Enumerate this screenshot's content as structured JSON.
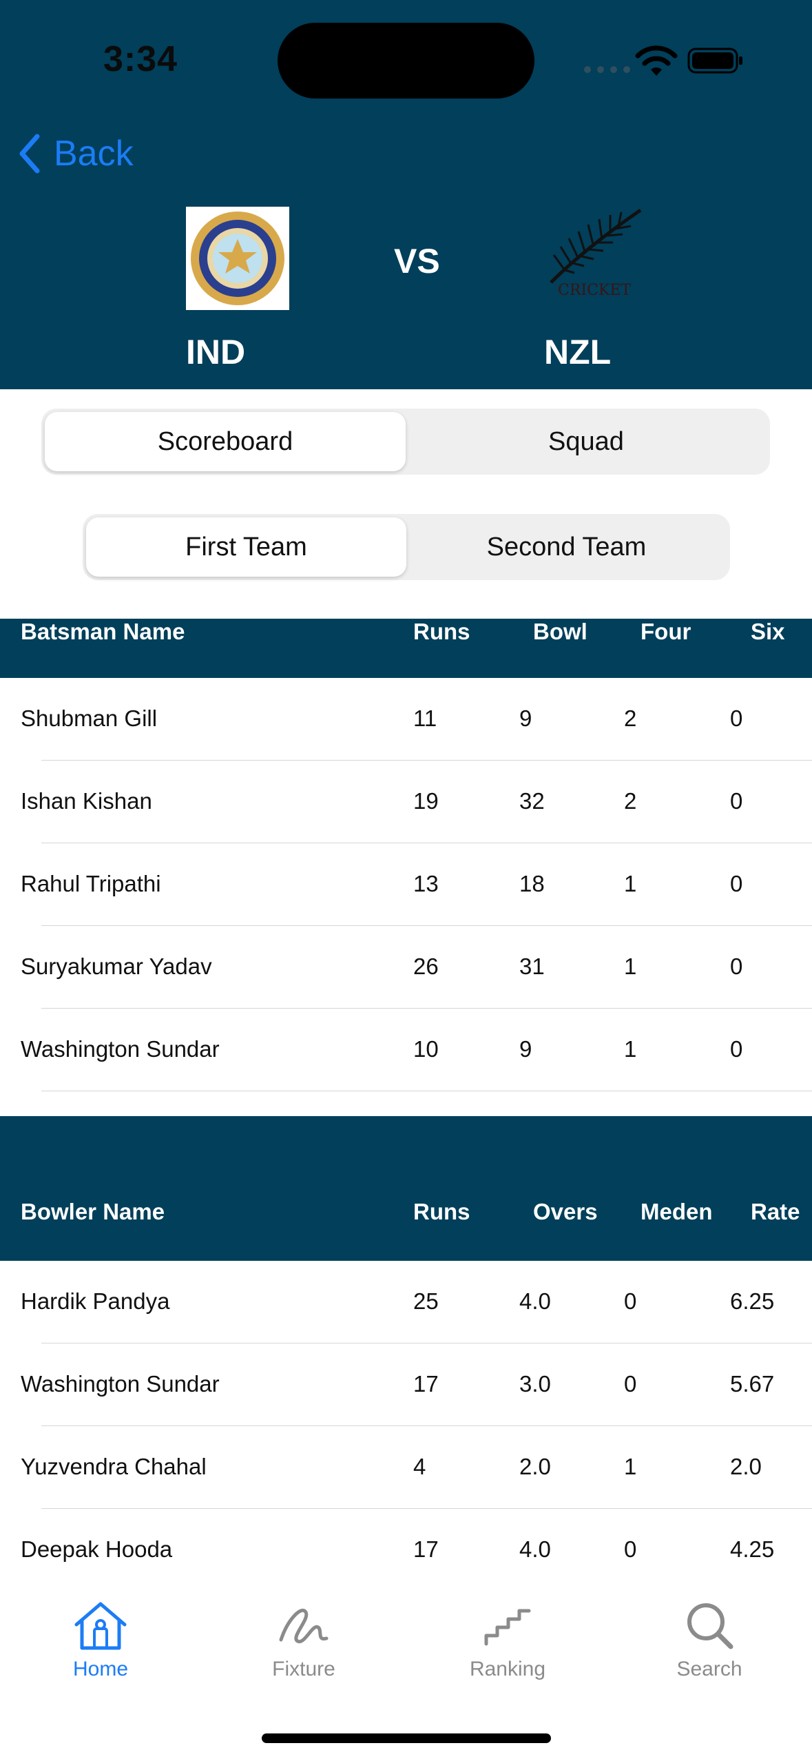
{
  "status_bar": {
    "time": "3:34"
  },
  "nav": {
    "back_label": "Back"
  },
  "match": {
    "vs_label": "VS",
    "team1": {
      "code": "IND"
    },
    "team2": {
      "code": "NZL"
    }
  },
  "segment_main": {
    "options": [
      "Scoreboard",
      "Squad"
    ],
    "selected": "Scoreboard"
  },
  "segment_team": {
    "options": [
      "First Team",
      "Second Team"
    ],
    "selected": "First Team"
  },
  "batting": {
    "headers": [
      "Batsman Name",
      "Runs",
      "Bowl",
      "Four",
      "Six"
    ],
    "rows": [
      [
        "Shubman Gill",
        "11",
        "9",
        "2",
        "0"
      ],
      [
        "Ishan Kishan",
        "19",
        "32",
        "2",
        "0"
      ],
      [
        "Rahul Tripathi",
        "13",
        "18",
        "1",
        "0"
      ],
      [
        "Suryakumar Yadav",
        "26",
        "31",
        "1",
        "0"
      ],
      [
        "Washington Sundar",
        "10",
        "9",
        "1",
        "0"
      ]
    ]
  },
  "bowling": {
    "headers": [
      "Bowler Name",
      "Runs",
      "Overs",
      "Meden",
      "Rate"
    ],
    "rows": [
      [
        "Hardik Pandya",
        "25",
        "4.0",
        "0",
        "6.25"
      ],
      [
        "Washington Sundar",
        "17",
        "3.0",
        "0",
        "5.67"
      ],
      [
        "Yuzvendra Chahal",
        "4",
        "2.0",
        "1",
        "2.0"
      ],
      [
        "Deepak Hooda",
        "17",
        "4.0",
        "0",
        "4.25"
      ]
    ]
  },
  "tab_bar": {
    "tabs": [
      {
        "label": "Home",
        "icon": "home-icon"
      },
      {
        "label": "Fixture",
        "icon": "scribble-icon"
      },
      {
        "label": "Ranking",
        "icon": "stairs-icon"
      },
      {
        "label": "Search",
        "icon": "search-icon"
      }
    ],
    "selected": "Home"
  },
  "colors": {
    "header_bg": "#013F5A",
    "accent": "#1C7CF5",
    "inactive": "#8B8B8B"
  }
}
